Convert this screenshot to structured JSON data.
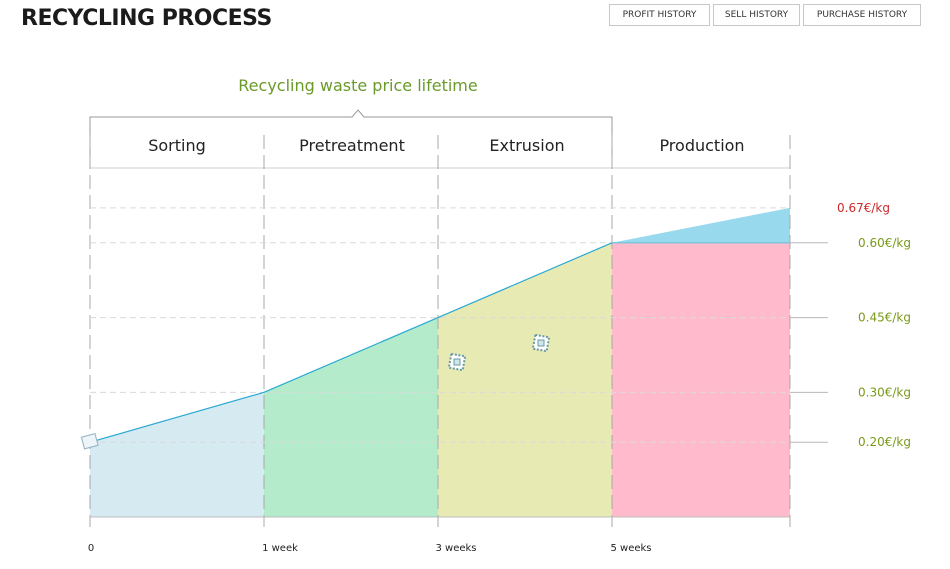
{
  "header": {
    "title": "RECYCLING PROCESS",
    "buttons": {
      "profit_history": "PROFIT HISTORY",
      "sell_history": "SELL HISTORY",
      "purchase_history": "PURCHASE HISTORY"
    }
  },
  "colors": {
    "price_line": "#2aa9d2",
    "sorting_fill": "#d6eaf2",
    "pretreatment_fill": "#b4ebcb",
    "extrusion_fill": "#e8eab4",
    "production_fill": "#ffbacb",
    "margin_fill": "#98d9ee",
    "top_price_color": "#cc2a2a",
    "price_color": "#7a9a1a",
    "title_color": "#6a9a2a"
  },
  "chart_data": {
    "type": "area",
    "title": "Recycling waste price lifetime",
    "stages": [
      "Sorting",
      "Pretreatment",
      "Extrusion",
      "Production"
    ],
    "x_ticks": [
      "0",
      "1 week",
      "3 weeks",
      "5 weeks"
    ],
    "price_labels": [
      "0.67€/kg",
      "0.60€/kg",
      "0.45€/kg",
      "0.30€/kg",
      "0.20€/kg"
    ],
    "price_values": [
      0.67,
      0.6,
      0.45,
      0.3,
      0.2
    ],
    "series": [
      {
        "name": "",
        "x": [
          "0",
          "1 week",
          "3 weeks",
          "5 weeks"
        ],
        "values": [
          0.2,
          0.3,
          0.45,
          0.6
        ]
      }
    ],
    "final_price": 0.67,
    "ylim": [
      0.05,
      0.75
    ],
    "icons": [
      "start-marker-icon",
      "gear-icon",
      "gear-icon"
    ]
  }
}
